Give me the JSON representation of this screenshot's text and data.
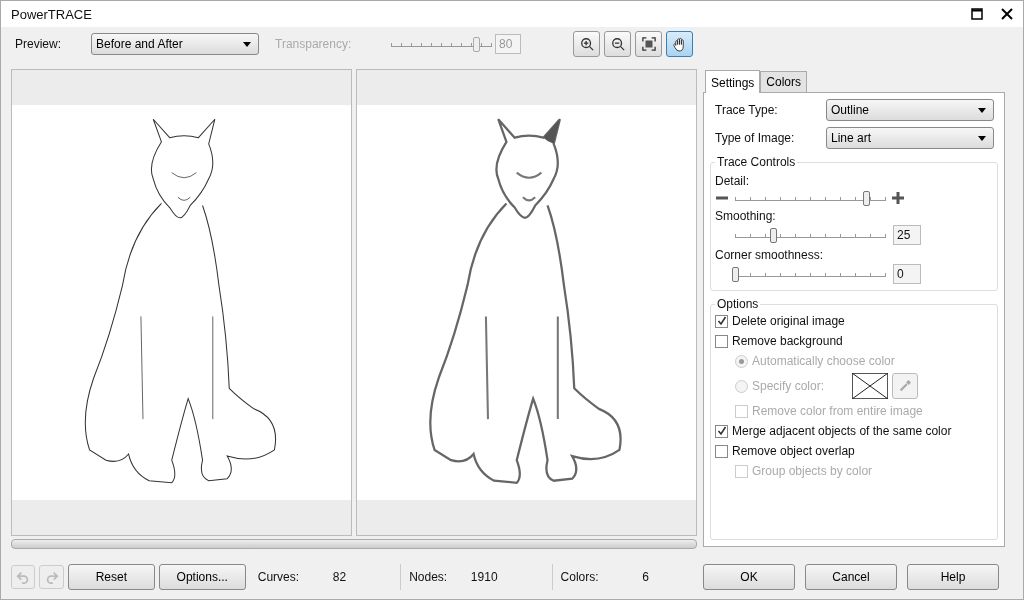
{
  "window": {
    "title": "PowerTRACE"
  },
  "toolbar": {
    "preview_label": "Preview:",
    "preview_value": "Before and After",
    "transparency_label": "Transparency:",
    "transparency": {
      "level": 0.85,
      "disabled": true
    },
    "transparency_value": "80",
    "pan_tool_selected": true
  },
  "tabs": [
    {
      "label": "Settings",
      "selected": true
    },
    {
      "label": "Colors",
      "selected": false
    }
  ],
  "settings": {
    "fields": [
      {
        "label": "Trace Type:",
        "value": "Outline"
      },
      {
        "label": "Type of Image:",
        "value": "Line art"
      }
    ],
    "trace_controls": {
      "title": "Trace Controls",
      "sliders": [
        {
          "label": "Detail:",
          "level": 0.87,
          "kind": "plusminus"
        },
        {
          "label": "Smoothing:",
          "level": 0.25,
          "kind": "value",
          "reading": "25"
        },
        {
          "label": "Corner smoothness:",
          "level": 0,
          "kind": "value",
          "reading": "0"
        }
      ]
    },
    "options": {
      "title": "Options",
      "items": [
        {
          "kind": "checkbox",
          "label": "Delete original image",
          "checked": true,
          "disabled": false
        },
        {
          "kind": "checkbox",
          "label": "Remove background",
          "checked": false,
          "disabled": false,
          "children": [
            {
              "kind": "radio",
              "label": "Automatically choose color",
              "checked": true,
              "disabled": true
            },
            {
              "kind": "color-radio",
              "label": "Specify color:",
              "checked": false,
              "disabled": true
            },
            {
              "kind": "checkbox",
              "label": "Remove color from entire image",
              "checked": false,
              "disabled": true
            }
          ]
        },
        {
          "kind": "checkbox",
          "label": "Merge adjacent objects of the same color",
          "checked": true,
          "disabled": false
        },
        {
          "kind": "checkbox",
          "label": "Remove object overlap",
          "checked": false,
          "disabled": false,
          "children": [
            {
              "kind": "checkbox",
              "label": "Group objects by color",
              "checked": false,
              "disabled": true
            }
          ]
        }
      ]
    }
  },
  "bottom": {
    "buttons": [
      "Reset",
      "Options..."
    ],
    "stats": [
      {
        "label": "Curves:",
        "value": "82"
      },
      {
        "label": "Nodes:",
        "value": "1910"
      },
      {
        "label": "Colors:",
        "value": "6"
      }
    ],
    "dialog_buttons": [
      "OK",
      "Cancel",
      "Help"
    ]
  }
}
